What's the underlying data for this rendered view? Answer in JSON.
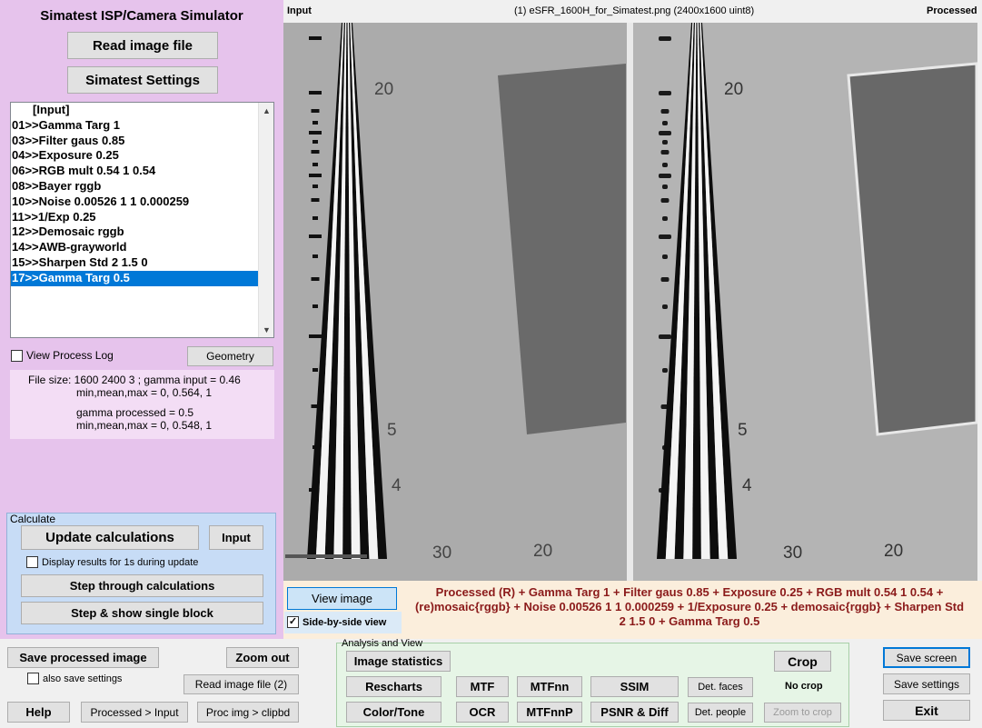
{
  "app": {
    "title": "Simatest ISP/Camera Simulator",
    "read_image_label": "Read image file",
    "settings_label": "Simatest Settings"
  },
  "process_list": {
    "items": [
      "[Input]",
      "01>>Gamma Targ 1",
      "03>>Filter gaus 0.85",
      "04>>Exposure 0.25",
      "06>>RGB mult 0.54 1 0.54",
      "08>>Bayer rggb",
      "10>>Noise 0.00526 1 1 0.000259",
      "11>>1/Exp 0.25",
      "12>>Demosaic rggb",
      "14>>AWB-grayworld",
      "15>>Sharpen Std 2 1.5 0",
      "17>>Gamma Targ 0.5"
    ],
    "selected_index": 11
  },
  "options": {
    "view_log_label": "View Process Log",
    "geometry_label": "Geometry"
  },
  "file_info": {
    "line1": "File size:  1600  2400      3 ;   gamma input = 0.46",
    "line2": "min,mean,max = 0, 0.564, 1",
    "line3": "gamma processed = 0.5",
    "line4": "min,mean,max = 0, 0.548, 1"
  },
  "calculate": {
    "legend": "Calculate",
    "update_label": "Update calculations",
    "input_label": "Input",
    "display_results_label": "Display results for 1s during update",
    "step_label": "Step through calculations",
    "step_show_label": "Step & show single block"
  },
  "header": {
    "input_label": "Input",
    "file_label": "(1) eSFR_1600H_for_Simatest.png  (2400x1600  uint8)",
    "processed_label": "Processed"
  },
  "chart_image": {
    "labels": {
      "l20": "20",
      "l5": "5",
      "l4": "4",
      "l30": "30",
      "l20b": "20"
    }
  },
  "view": {
    "view_image_label": "View image",
    "side_by_side_label": "Side-by-side view",
    "side_by_side_checked": true
  },
  "caption": {
    "text": "Processed (R)  + Gamma Targ 1 + Filter gaus 0.85 + Exposure 0.25 + RGB mult 0.54 1 0.54 + (re)mosaic{rggb} + Noise 0.00526 1 1 0.000259 + 1/Exposure 0.25 + demosaic{rggb} + Sharpen Std  2 1.5 0 + Gamma Targ 0.5"
  },
  "bottom": {
    "save_processed_label": "Save processed image",
    "also_save_label": "also save settings",
    "zoom_out_label": "Zoom out",
    "read_image2_label": "Read image file (2)",
    "help_label": "Help",
    "proc_input_label": "Processed > Input",
    "proc_clip_label": "Proc img > clipbd",
    "save_screen_label": "Save screen",
    "save_settings_label": "Save settings",
    "exit_label": "Exit"
  },
  "analysis": {
    "legend": "Analysis and View",
    "image_stats_label": "Image statistics",
    "crop_label": "Crop",
    "rescharts_label": "Rescharts",
    "mtf_label": "MTF",
    "mtfnn_label": "MTFnn",
    "ssim_label": "SSIM",
    "det_faces_label": "Det. faces",
    "no_crop_label": "No crop",
    "color_tone_label": "Color/Tone",
    "ocr_label": "OCR",
    "mtfnnp_label": "MTFnnP",
    "psnr_label": "PSNR & Diff",
    "det_people_label": "Det. people",
    "zoom_crop_label": "Zoom to crop"
  },
  "colors": {
    "left_panel": "#e6c3ec",
    "selection": "#0078d7",
    "caption_text": "#8b1a1a",
    "calc_group": "#c7dcf6",
    "analysis_group": "#e6f5e6"
  }
}
